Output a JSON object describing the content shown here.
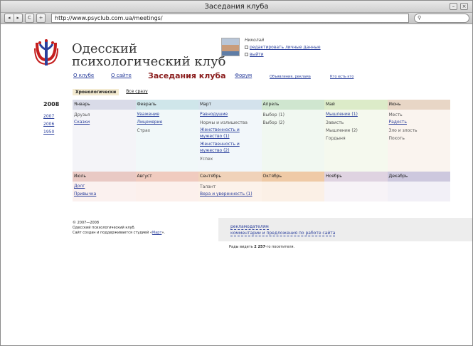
{
  "window": {
    "title": "Заседания клуба"
  },
  "browser": {
    "url": "http://www.psyclub.com.ua/meetings/",
    "back": "◂",
    "forward": "▸",
    "reload": "C",
    "add": "+",
    "search_icon": "search-icon"
  },
  "brand": {
    "line1": "Одесский",
    "line2": "психологический клуб"
  },
  "user": {
    "name": "Николай",
    "edit": "редактировать личные данные",
    "logout": "выйти"
  },
  "menu": {
    "about": "О клубе",
    "site": "О сайте",
    "current": "Заседания клуба",
    "forum": "Форум",
    "ads": "Объявления, реклама",
    "who": "Кто есть кто"
  },
  "tabs": {
    "chrono": "Хронологически",
    "all": "Все сразу"
  },
  "years": {
    "current": "2008",
    "list": [
      "2007",
      "2006",
      "1950"
    ]
  },
  "months_top": [
    {
      "name": "Январь",
      "color": "#d9dbe8",
      "bg": "#f4f4f8",
      "items": [
        {
          "t": "Друзья",
          "link": false
        },
        {
          "t": "Сказки",
          "link": true
        }
      ]
    },
    {
      "name": "Февраль",
      "color": "#cfe6ea",
      "bg": "#f1f8f9",
      "items": [
        {
          "t": "Уважение",
          "link": true
        },
        {
          "t": "Лицемерие",
          "link": true
        },
        {
          "t": "Страх",
          "link": false
        }
      ]
    },
    {
      "name": "Март",
      "color": "#d3e2ec",
      "bg": "#f2f7fa",
      "items": [
        {
          "t": "Равнодушие",
          "link": true
        },
        {
          "t": "Нормы и излишества",
          "link": false
        },
        {
          "t": "Женственность и мужество (1)",
          "link": true
        },
        {
          "t": "Женственность и мужество (2)",
          "link": true
        },
        {
          "t": "Успех",
          "link": false
        }
      ]
    },
    {
      "name": "Апрель",
      "color": "#cfe6cf",
      "bg": "#f1f8f1",
      "items": [
        {
          "t": "Выбор (1)",
          "link": false
        },
        {
          "t": "Выбор (2)",
          "link": false
        }
      ]
    },
    {
      "name": "Май",
      "color": "#dcebc8",
      "bg": "#f5f9ee",
      "items": [
        {
          "t": "Мышление (1)",
          "link": true
        },
        {
          "t": "Зависть",
          "link": false
        },
        {
          "t": "Мышление (2)",
          "link": false
        },
        {
          "t": "Гордыня",
          "link": false
        }
      ]
    },
    {
      "name": "Июнь",
      "color": "#e8d6c6",
      "bg": "#faf4ef",
      "items": [
        {
          "t": "Месть",
          "link": false
        },
        {
          "t": "Радость",
          "link": true
        },
        {
          "t": "Зло и злость",
          "link": false
        },
        {
          "t": "Похоть",
          "link": false
        }
      ]
    }
  ],
  "months_bottom": [
    {
      "name": "Июль",
      "color": "#e9c9c4",
      "bg": "#fbf1ef",
      "items": [
        {
          "t": "Долг",
          "link": true
        },
        {
          "t": "Привычка",
          "link": true
        }
      ]
    },
    {
      "name": "Август",
      "color": "#f0cbbf",
      "bg": "#fcf0ec",
      "items": []
    },
    {
      "name": "Сентябрь",
      "color": "#f0d2b9",
      "bg": "#fcf2ea",
      "items": [
        {
          "t": "Талант",
          "link": false
        },
        {
          "t": "Вера и уверенность (1)",
          "link": true
        }
      ]
    },
    {
      "name": "Октябрь",
      "color": "#efcaa6",
      "bg": "#fbf0e6",
      "items": []
    },
    {
      "name": "Ноябрь",
      "color": "#dfd3e1",
      "bg": "#f7f3f7",
      "items": []
    },
    {
      "name": "Декабрь",
      "color": "#cdc8de",
      "bg": "#f2f0f7",
      "items": []
    }
  ],
  "footer": {
    "copyright": "© 2007—2008",
    "club": "Одесский психологический клуб.",
    "made": "Сайт создан и поддерживается студией «",
    "studio": "Март",
    "made_end": "».",
    "advertisers": "рекламодателям",
    "feedback": "комментарии и предложения по работе сайта",
    "visit_pre": "Рады видеть ",
    "visit_num": "2 257",
    "visit_post": "-го посетителя."
  }
}
